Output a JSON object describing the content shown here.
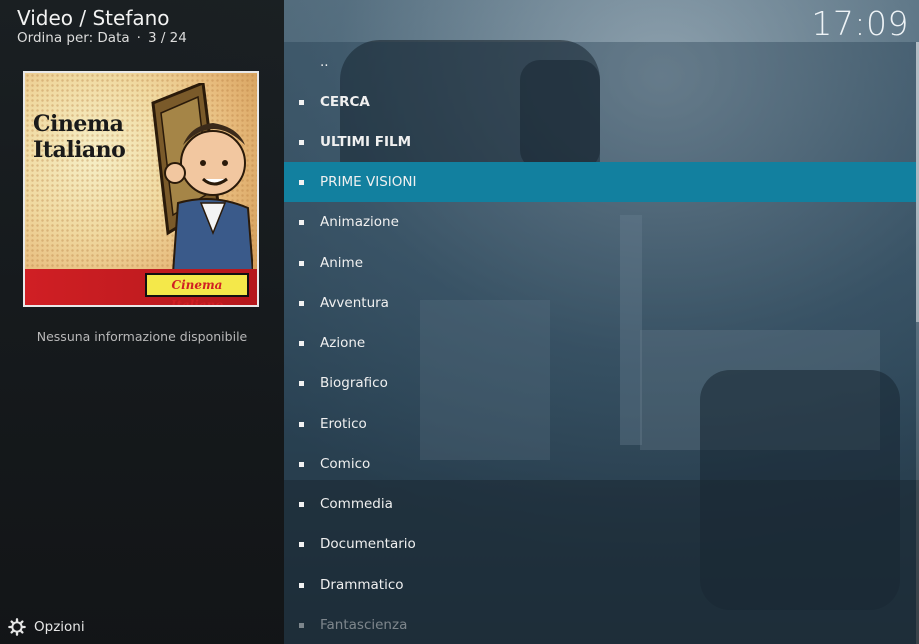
{
  "header": {
    "title": "Video / Stefano",
    "sort_label": "Ordina per: Data",
    "separator": "·",
    "position": "3 / 24"
  },
  "clock": "17:09",
  "poster": {
    "title_line1": "Cinema",
    "title_line2": "Italiano",
    "banner_text": "Cinema Italiano"
  },
  "info": "Nessuna informazione disponibile",
  "footer": {
    "options_label": "Opzioni",
    "options_icon": "gear-icon"
  },
  "list": {
    "items": [
      {
        "label": "..",
        "bold": false,
        "selected": false,
        "bullet": false
      },
      {
        "label": "CERCA",
        "bold": true,
        "selected": false,
        "bullet": true
      },
      {
        "label": "ULTIMI FILM",
        "bold": true,
        "selected": false,
        "bullet": true
      },
      {
        "label": "PRIME VISIONI",
        "bold": false,
        "selected": true,
        "bullet": true
      },
      {
        "label": "Animazione",
        "bold": false,
        "selected": false,
        "bullet": true
      },
      {
        "label": "Anime",
        "bold": false,
        "selected": false,
        "bullet": true
      },
      {
        "label": "Avventura",
        "bold": false,
        "selected": false,
        "bullet": true
      },
      {
        "label": "Azione",
        "bold": false,
        "selected": false,
        "bullet": true
      },
      {
        "label": "Biografico",
        "bold": false,
        "selected": false,
        "bullet": true
      },
      {
        "label": "Erotico",
        "bold": false,
        "selected": false,
        "bullet": true
      },
      {
        "label": "Comico",
        "bold": false,
        "selected": false,
        "bullet": true
      },
      {
        "label": "Commedia",
        "bold": false,
        "selected": false,
        "bullet": true
      },
      {
        "label": "Documentario",
        "bold": false,
        "selected": false,
        "bullet": true
      },
      {
        "label": "Drammatico",
        "bold": false,
        "selected": false,
        "bullet": true
      },
      {
        "label": "Fantascienza",
        "bold": false,
        "selected": false,
        "bullet": true,
        "faded": true
      }
    ]
  },
  "colors": {
    "selection": "#12809f",
    "panel": "#161a1c"
  }
}
